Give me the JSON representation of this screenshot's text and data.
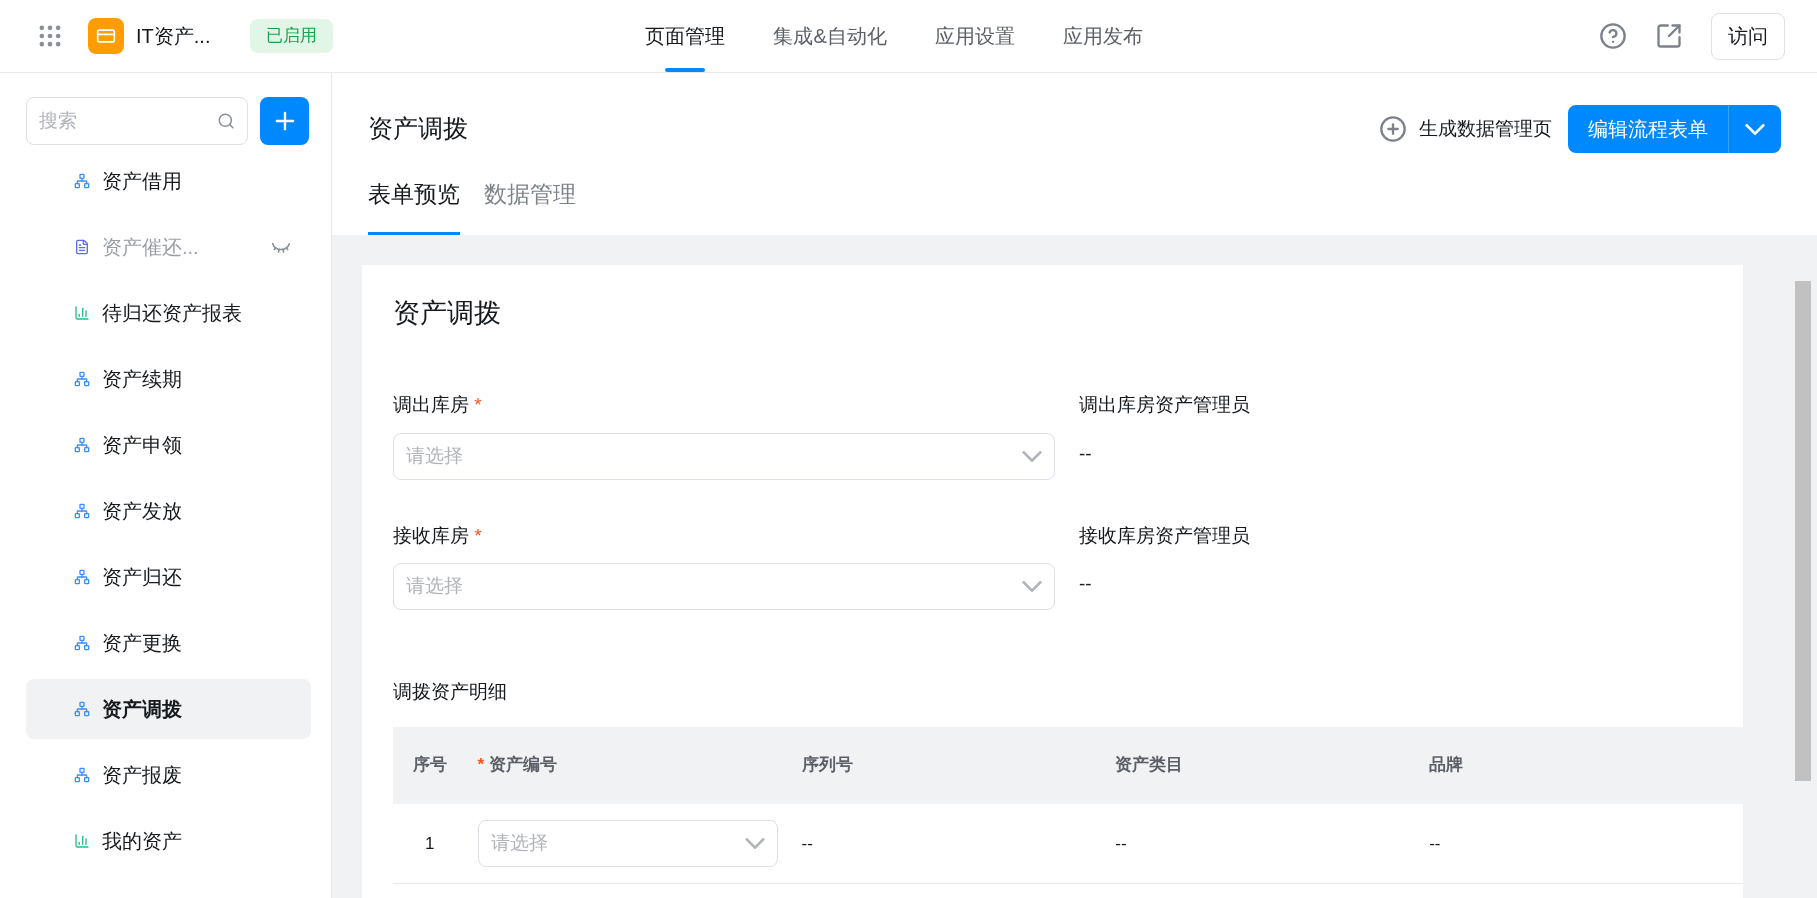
{
  "app": {
    "name": "IT资产...",
    "status": "已启用"
  },
  "nav_tabs": [
    {
      "label": "页面管理",
      "selected": true
    },
    {
      "label": "集成&自动化",
      "selected": false
    },
    {
      "label": "应用设置",
      "selected": false
    },
    {
      "label": "应用发布",
      "selected": false
    }
  ],
  "visit_button": "访问",
  "sidebar": {
    "search": {
      "placeholder": "搜索"
    },
    "items": [
      {
        "label": "资产借用",
        "kind": "flow",
        "hidden": false,
        "selected": false
      },
      {
        "label": "资产催还...",
        "kind": "form",
        "hidden": true,
        "selected": false
      },
      {
        "label": "待归还资产报表",
        "kind": "report",
        "hidden": false,
        "selected": false
      },
      {
        "label": "资产续期",
        "kind": "flow",
        "hidden": false,
        "selected": false
      },
      {
        "label": "资产申领",
        "kind": "flow",
        "hidden": false,
        "selected": false
      },
      {
        "label": "资产发放",
        "kind": "flow",
        "hidden": false,
        "selected": false
      },
      {
        "label": "资产归还",
        "kind": "flow",
        "hidden": false,
        "selected": false
      },
      {
        "label": "资产更换",
        "kind": "flow",
        "hidden": false,
        "selected": false
      },
      {
        "label": "资产调拨",
        "kind": "flow",
        "hidden": false,
        "selected": true
      },
      {
        "label": "资产报废",
        "kind": "flow",
        "hidden": false,
        "selected": false
      },
      {
        "label": "我的资产",
        "kind": "report",
        "hidden": false,
        "selected": false
      }
    ]
  },
  "page": {
    "title": "资产调拨",
    "generate_link": "生成数据管理页",
    "edit_button": "编辑流程表单",
    "tabs": [
      {
        "label": "表单预览",
        "selected": true
      },
      {
        "label": "数据管理",
        "selected": false
      }
    ]
  },
  "form": {
    "title": "资产调拨",
    "required_mark": "*",
    "fields": [
      {
        "label": "调出库房",
        "required": true,
        "placeholder": "请选择",
        "side_label": "调出库房资产管理员",
        "side_value": "--"
      },
      {
        "label": "接收库房",
        "required": true,
        "placeholder": "请选择",
        "side_label": "接收库房资产管理员",
        "side_value": "--"
      }
    ],
    "table": {
      "title": "调拨资产明细",
      "columns": [
        {
          "label": "序号",
          "required": false
        },
        {
          "label": "资产编号",
          "required": true
        },
        {
          "label": "序列号",
          "required": false
        },
        {
          "label": "资产类目",
          "required": false
        },
        {
          "label": "品牌",
          "required": false
        }
      ],
      "rows": [
        {
          "cells": [
            {
              "kind": "text",
              "text": "1"
            },
            {
              "kind": "select",
              "placeholder": "请选择"
            },
            {
              "kind": "text",
              "text": "--"
            },
            {
              "kind": "text",
              "text": "--"
            },
            {
              "kind": "text",
              "text": "--"
            }
          ]
        }
      ]
    }
  }
}
